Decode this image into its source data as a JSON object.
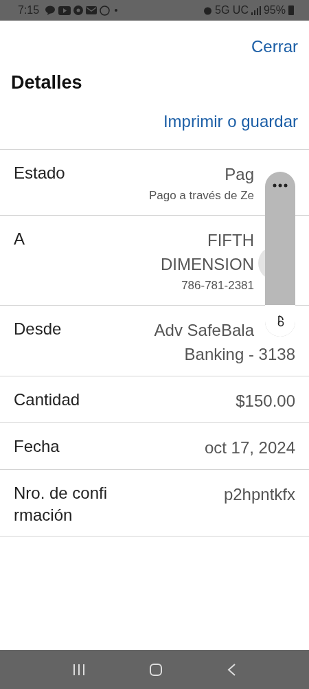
{
  "status_bar": {
    "time": "7:15",
    "network": "5G UC",
    "battery": "95%"
  },
  "header": {
    "close": "Cerrar",
    "title": "Detalles",
    "print": "Imprimir o guardar"
  },
  "rows": [
    {
      "label": "Estado",
      "lines": [
        {
          "kind": "main",
          "text": "Pag"
        },
        {
          "kind": "sub",
          "text": "Pago a través de Ze"
        }
      ]
    },
    {
      "label": "A",
      "lines": [
        {
          "kind": "main",
          "text": "FIFTH"
        },
        {
          "kind": "main",
          "text": "DIMENSION"
        },
        {
          "kind": "sub",
          "text": "786-781-2381"
        }
      ]
    },
    {
      "label": "Desde",
      "lines": [
        {
          "kind": "main",
          "text": "Adv SafeBala"
        },
        {
          "kind": "main",
          "text": "Banking - 3138"
        }
      ]
    },
    {
      "label": "Cantidad",
      "lines": [
        {
          "kind": "main",
          "text": "$150.00"
        }
      ]
    },
    {
      "label": "Fecha",
      "lines": [
        {
          "kind": "main",
          "text": "oct 17, 2024"
        }
      ]
    },
    {
      "label": "Nro. de confi rmación",
      "lines": [
        {
          "kind": "main",
          "text": "p2hpntkfx"
        }
      ]
    }
  ]
}
